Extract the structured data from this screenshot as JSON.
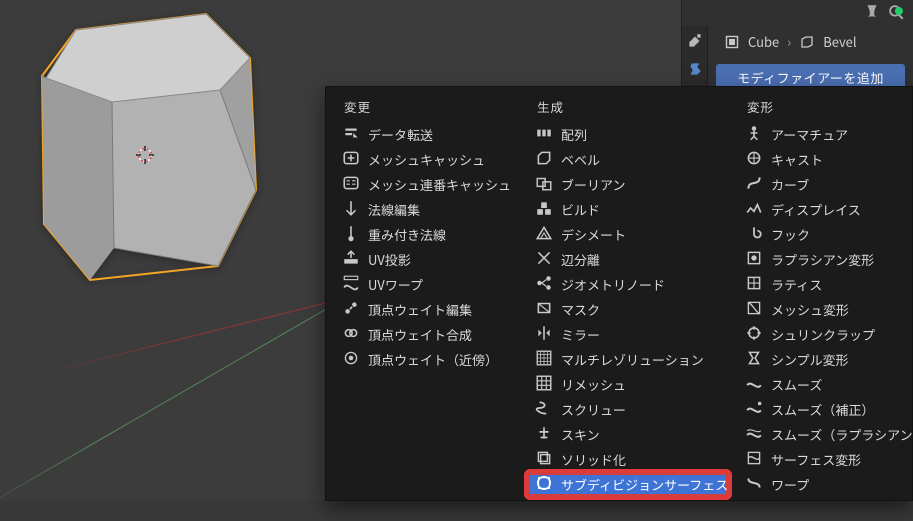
{
  "viewport": {
    "object_name": "Cube",
    "active_modifier": "Bevel"
  },
  "properties": {
    "add_modifier_label": "モディファイアーを追加"
  },
  "menu": {
    "columns": [
      {
        "header": "変更",
        "items": [
          {
            "icon": "data",
            "label": "データ転送"
          },
          {
            "icon": "meshcache",
            "label": "メッシュキャッシュ"
          },
          {
            "icon": "meshseq",
            "label": "メッシュ連番キャッシュ"
          },
          {
            "icon": "normal",
            "label": "法線編集"
          },
          {
            "icon": "weightnormal",
            "label": "重み付き法線"
          },
          {
            "icon": "uvproj",
            "label": "UV投影"
          },
          {
            "icon": "uvwarp",
            "label": "UVワープ"
          },
          {
            "icon": "vwedit",
            "label": "頂点ウェイト編集"
          },
          {
            "icon": "vwmix",
            "label": "頂点ウェイト合成"
          },
          {
            "icon": "vwprox",
            "label": "頂点ウェイト（近傍）"
          }
        ]
      },
      {
        "header": "生成",
        "items": [
          {
            "icon": "array",
            "label": "配列"
          },
          {
            "icon": "bevel",
            "label": "ベベル"
          },
          {
            "icon": "boolean",
            "label": "ブーリアン"
          },
          {
            "icon": "build",
            "label": "ビルド"
          },
          {
            "icon": "decimate",
            "label": "デシメート"
          },
          {
            "icon": "edgesplit",
            "label": "辺分離"
          },
          {
            "icon": "geonodes",
            "label": "ジオメトリノード"
          },
          {
            "icon": "mask",
            "label": "マスク"
          },
          {
            "icon": "mirror",
            "label": "ミラー"
          },
          {
            "icon": "multires",
            "label": "マルチレゾリューション"
          },
          {
            "icon": "remesh",
            "label": "リメッシュ"
          },
          {
            "icon": "screw",
            "label": "スクリュー"
          },
          {
            "icon": "skin",
            "label": "スキン"
          },
          {
            "icon": "solidify",
            "label": "ソリッド化"
          },
          {
            "icon": "subsurf",
            "label": "サブディビジョンサーフェス",
            "highlight": true
          }
        ]
      },
      {
        "header": "変形",
        "items": [
          {
            "icon": "armature",
            "label": "アーマチュア"
          },
          {
            "icon": "cast",
            "label": "キャスト"
          },
          {
            "icon": "curve",
            "label": "カーブ"
          },
          {
            "icon": "displace",
            "label": "ディスプレイス"
          },
          {
            "icon": "hook",
            "label": "フック"
          },
          {
            "icon": "laplacian",
            "label": "ラプラシアン変形"
          },
          {
            "icon": "lattice",
            "label": "ラティス"
          },
          {
            "icon": "meshdeform",
            "label": "メッシュ変形"
          },
          {
            "icon": "shrinkwrap",
            "label": "シュリンクラップ"
          },
          {
            "icon": "simpledeform",
            "label": "シンプル変形"
          },
          {
            "icon": "smooth",
            "label": "スムーズ"
          },
          {
            "icon": "smoothcorr",
            "label": "スムーズ（補正）"
          },
          {
            "icon": "smoothlap",
            "label": "スムーズ（ラプラシアン）"
          },
          {
            "icon": "surfacedeform",
            "label": "サーフェス変形"
          },
          {
            "icon": "warp",
            "label": "ワープ"
          }
        ]
      }
    ]
  },
  "colors": {
    "panel": "#303030",
    "menu_bg": "#1b1b1b",
    "highlight": "#3d74d6",
    "highlight_frame": "#e03a3a",
    "add_button": "#4a6fb3",
    "selection_outline": "#f5a623"
  }
}
